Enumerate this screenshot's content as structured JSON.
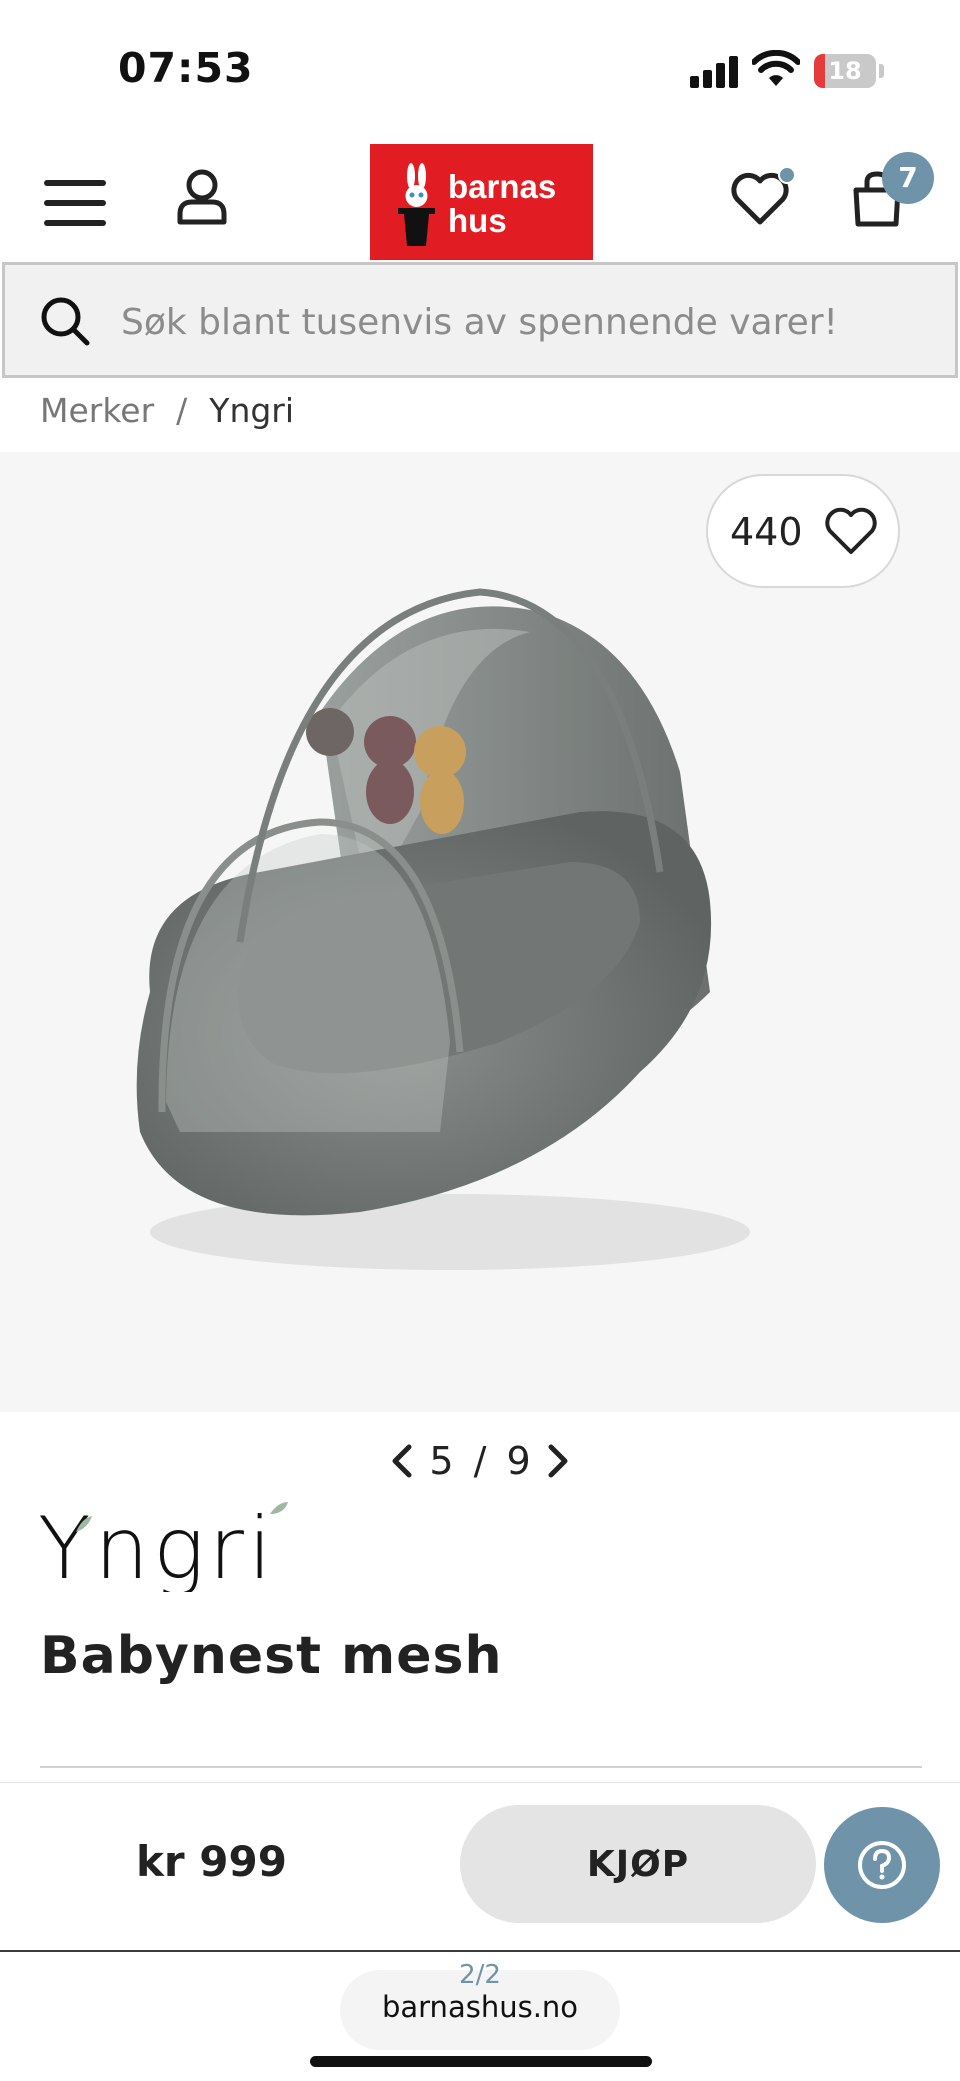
{
  "status_bar": {
    "time": "07:53",
    "battery_level": "18",
    "battery_fraction": 0.18
  },
  "header": {
    "logo_text_line1": "barnas",
    "logo_text_line2": "hus",
    "cart_count": "7",
    "brand_color": "#e21c23",
    "accent_color": "#6f94aa"
  },
  "search": {
    "placeholder": "Søk blant tusenvis av spennende varer!"
  },
  "breadcrumb": {
    "items": [
      "Merker",
      "Yngri"
    ],
    "separator": "/"
  },
  "gallery": {
    "favorites_count": "440",
    "current_image": "5",
    "total_images": "9",
    "separator": "/"
  },
  "product": {
    "brand": "Yngri",
    "title": "Babynest mesh"
  },
  "buy_bar": {
    "price": "kr 999",
    "buy_label": "KJØP"
  },
  "browser": {
    "page_count": "2/2",
    "url": "barnashus.no"
  },
  "icons": [
    "menu-icon",
    "account-icon",
    "heart-icon",
    "cart-icon",
    "search-icon",
    "chevron-left-icon",
    "chevron-right-icon",
    "help-icon"
  ]
}
